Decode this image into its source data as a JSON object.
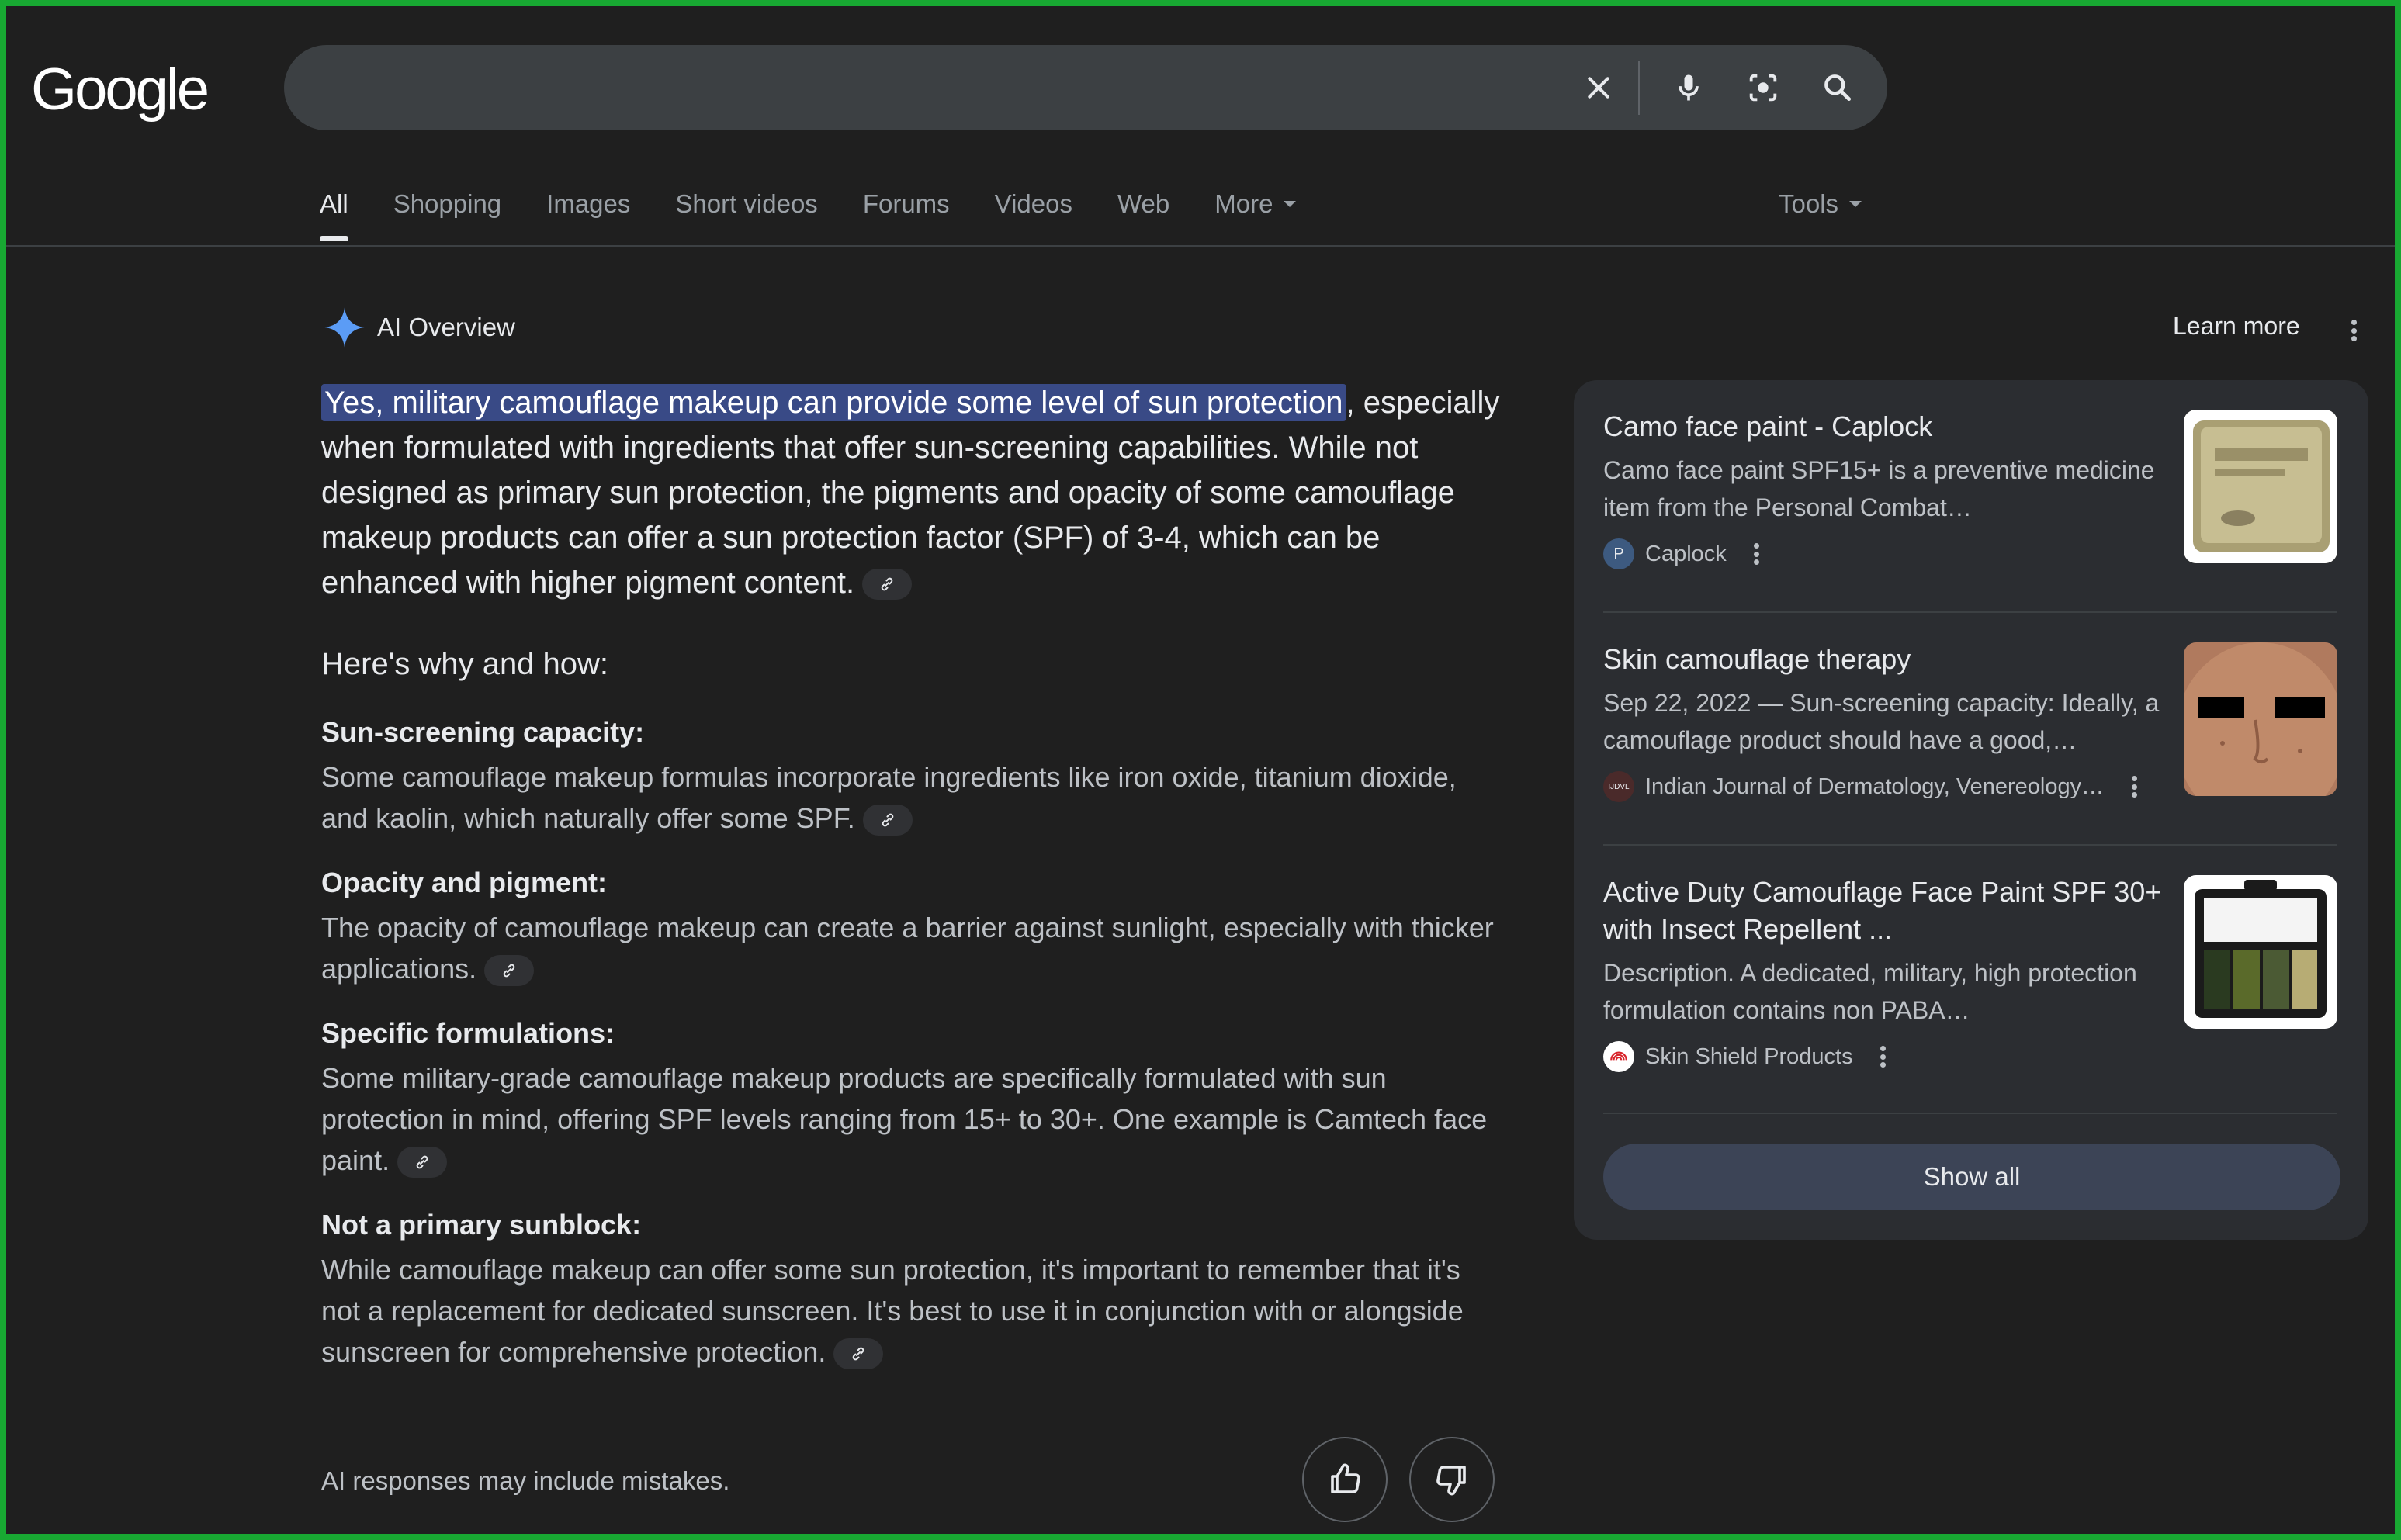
{
  "header": {
    "logo": "Google",
    "search": {
      "value": ""
    }
  },
  "tabs": [
    {
      "label": "All",
      "active": true
    },
    {
      "label": "Shopping"
    },
    {
      "label": "Images"
    },
    {
      "label": "Short videos"
    },
    {
      "label": "Forums"
    },
    {
      "label": "Videos"
    },
    {
      "label": "Web"
    },
    {
      "label": "More"
    }
  ],
  "tools_label": "Tools",
  "ai_overview": {
    "title": "AI Overview",
    "learn_more": "Learn more",
    "lead_highlight": "Yes, military camouflage makeup can provide some level of sun protection",
    "lead_rest": ", especially when formulated with ingredients that offer sun-screening capabilities. While not designed as primary sun protection, the pigments and opacity of some camouflage makeup products can offer a sun protection factor (SPF) of 3-4, which can be enhanced with higher pigment content.",
    "why_heading": "Here's why and how:",
    "sections": [
      {
        "heading": "Sun-screening capacity:",
        "text": "Some camouflage makeup formulas incorporate ingredients like iron oxide, titanium dioxide, and kaolin, which naturally offer some SPF."
      },
      {
        "heading": "Opacity and pigment:",
        "text": "The opacity of camouflage makeup can create a barrier against sunlight, especially with thicker applications."
      },
      {
        "heading": "Specific formulations:",
        "text": "Some military-grade camouflage makeup products are specifically formulated with sun protection in mind, offering SPF levels ranging from 15+ to 30+. One example is Camtech face paint."
      },
      {
        "heading": "Not a primary sunblock:",
        "text": "While camouflage makeup can offer some sun protection, it's important to remember that it's not a replacement for dedicated sunscreen. It's best to use it in conjunction with or alongside sunscreen for comprehensive protection."
      }
    ],
    "disclaimer": "AI responses may include mistakes."
  },
  "sources": [
    {
      "title": "Camo face paint - Caplock",
      "desc": "Camo face paint SPF15+ is a preventive medicine item from the Personal Combat…",
      "site": "Caplock",
      "favicon_letter": "P"
    },
    {
      "title": "Skin camouflage therapy",
      "desc": "Sep 22, 2022 — Sun-screening capacity: Ideally, a camouflage product should have a good,…",
      "site": "Indian Journal of Dermatology, Venereology…",
      "favicon_letter": "IJDVL"
    },
    {
      "title": "Active Duty Camouflage Face Paint SPF 30+ with Insect Repellent ...",
      "desc": "Description. A dedicated, military, high protection formulation contains non PABA…",
      "site": "Skin Shield Products",
      "favicon_letter": ""
    }
  ],
  "show_all": "Show all",
  "colors": {
    "background": "#1f1f1f",
    "highlight": "#394a86",
    "card": "#2b2d31",
    "frame": "#18a832"
  }
}
